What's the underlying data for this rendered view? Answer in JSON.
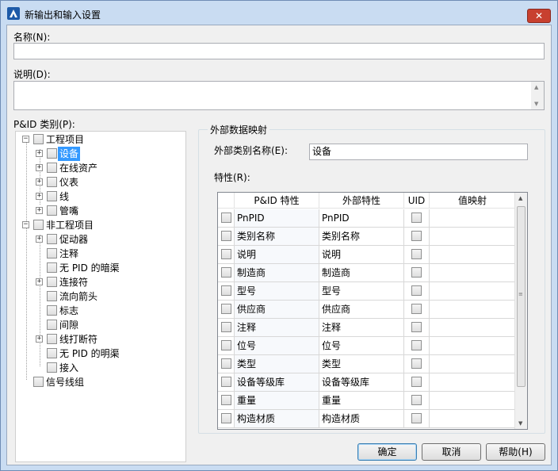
{
  "window": {
    "title": "新输出和输入设置",
    "close_label": "✕"
  },
  "name_label": "名称(N):",
  "name_value": "",
  "desc_label": "说明(D):",
  "desc_value": "",
  "tree_label": "P&ID 类别(P):",
  "tree": {
    "engineering": "工程项目",
    "equipment": "设备",
    "inline_assets": "在线资产",
    "instruments": "仪表",
    "lines": "线",
    "nozzles": "管嘴",
    "non_engineering": "非工程项目",
    "actuators": "促动器",
    "annotation": "注释",
    "no_pid_hidden": "无 PID 的暗渠",
    "connectors": "连接符",
    "flow_arrow": "流向箭头",
    "flags": "标志",
    "gap": "间隙",
    "line_breaks": "线打断符",
    "no_pid_visible": "无 PID 的明渠",
    "tie_in": "接入",
    "signal_line_group": "信号线组"
  },
  "external": {
    "group_title": "外部数据映射",
    "class_name_label": "外部类别名称(E):",
    "class_name_value": "设备",
    "properties_label": "特性(R):",
    "columns": [
      "P&ID 特性",
      "外部特性",
      "UID",
      "值映射"
    ],
    "rows": [
      {
        "pid": "PnPID",
        "ext": "PnPID"
      },
      {
        "pid": "类别名称",
        "ext": "类别名称"
      },
      {
        "pid": "说明",
        "ext": "说明"
      },
      {
        "pid": "制造商",
        "ext": "制造商"
      },
      {
        "pid": "型号",
        "ext": "型号"
      },
      {
        "pid": "供应商",
        "ext": "供应商"
      },
      {
        "pid": "注释",
        "ext": "注释"
      },
      {
        "pid": "位号",
        "ext": "位号"
      },
      {
        "pid": "类型",
        "ext": "类型"
      },
      {
        "pid": "设备等级库",
        "ext": "设备等级库"
      },
      {
        "pid": "重量",
        "ext": "重量"
      },
      {
        "pid": "构造材质",
        "ext": "构造材质"
      }
    ]
  },
  "buttons": {
    "ok": "确定",
    "cancel": "取消",
    "help": "帮助(H)"
  }
}
